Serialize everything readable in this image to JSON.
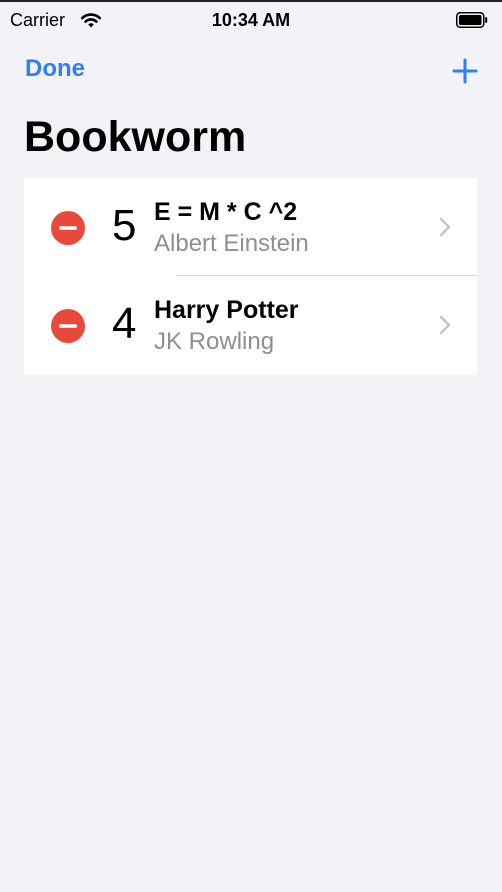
{
  "status_bar": {
    "carrier": "Carrier",
    "time": "10:34 AM",
    "wifi_icon": "wifi-icon",
    "battery_icon": "battery-icon"
  },
  "nav": {
    "done_label": "Done",
    "add_icon": "plus-icon"
  },
  "title": "Bookworm",
  "books": [
    {
      "rating": "5",
      "title": "E = M * C ^2",
      "author": "Albert Einstein"
    },
    {
      "rating": "4",
      "title": "Harry Potter",
      "author": "JK Rowling"
    }
  ],
  "icons": {
    "delete": "minus-circle-icon",
    "chevron": "chevron-right-icon"
  },
  "colors": {
    "accent": "#2f7ff6",
    "delete": "#e9493b",
    "background": "#f2f2f7",
    "secondary_text": "#8e8e93"
  }
}
